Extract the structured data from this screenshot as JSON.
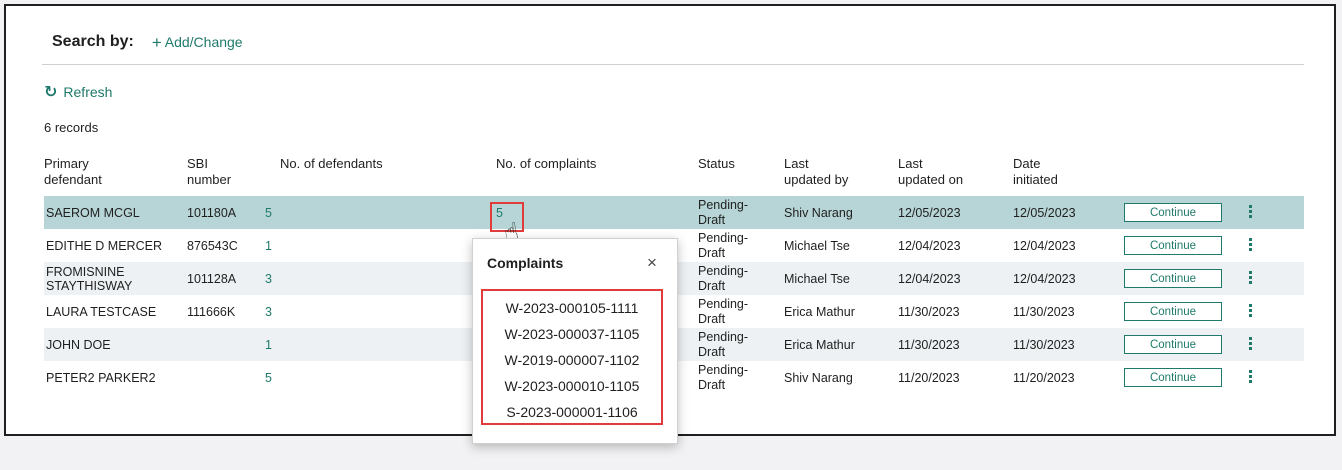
{
  "search": {
    "label": "Search by:",
    "add_change": "Add/Change"
  },
  "refresh_label": "Refresh",
  "record_count": "6 records",
  "table": {
    "headers": {
      "primary_defendant": [
        "Primary",
        "defendant"
      ],
      "sbi_number": [
        "SBI",
        "number"
      ],
      "num_defendants": "No. of defendants",
      "num_complaints": "No. of complaints",
      "status": "Status",
      "last_updated_by": [
        "Last",
        "updated by"
      ],
      "last_updated_on": [
        "Last",
        "updated on"
      ],
      "date_initiated": [
        "Date",
        "initiated"
      ]
    },
    "continue_label": "Continue",
    "rows": [
      {
        "defendant": [
          "SAEROM MCGL"
        ],
        "sbi": "101180A",
        "defendants": "5",
        "complaints": "5",
        "status": [
          "Pending-",
          "Draft"
        ],
        "updated_by": "Shiv Narang",
        "updated_on": "12/05/2023",
        "initiated": "12/05/2023"
      },
      {
        "defendant": [
          "EDITHE D MERCER"
        ],
        "sbi": "876543C",
        "defendants": "1",
        "complaints": "",
        "status": [
          "Pending-",
          "Draft"
        ],
        "updated_by": "Michael Tse",
        "updated_on": "12/04/2023",
        "initiated": "12/04/2023"
      },
      {
        "defendant": [
          "FROMISNINE",
          "STAYTHISWAY"
        ],
        "sbi": "101128A",
        "defendants": "3",
        "complaints": "",
        "status": [
          "Pending-",
          "Draft"
        ],
        "updated_by": "Michael Tse",
        "updated_on": "12/04/2023",
        "initiated": "12/04/2023"
      },
      {
        "defendant": [
          "LAURA TESTCASE"
        ],
        "sbi": "111666K",
        "defendants": "3",
        "complaints": "",
        "status": [
          "Pending-",
          "Draft"
        ],
        "updated_by": "Erica Mathur",
        "updated_on": "11/30/2023",
        "initiated": "11/30/2023"
      },
      {
        "defendant": [
          "JOHN DOE"
        ],
        "sbi": "",
        "defendants": "1",
        "complaints": "",
        "status": [
          "Pending-",
          "Draft"
        ],
        "updated_by": "Erica Mathur",
        "updated_on": "11/30/2023",
        "initiated": "11/30/2023"
      },
      {
        "defendant": [
          "PETER2 PARKER2"
        ],
        "sbi": "",
        "defendants": "5",
        "complaints": "",
        "status": [
          "Pending-",
          "Draft"
        ],
        "updated_by": "Shiv Narang",
        "updated_on": "11/20/2023",
        "initiated": "11/20/2023"
      }
    ]
  },
  "complaints_popup": {
    "title": "Complaints",
    "close_symbol": "×",
    "items": [
      "W-2023-000105-1111",
      "W-2023-000037-1105",
      "W-2019-000007-1102",
      "W-2023-000010-1105",
      "S-2023-000001-1106"
    ]
  },
  "icons": {
    "refresh": "refresh-icon",
    "plus": "plus-icon",
    "close": "close-icon",
    "kebab": "kebab-menu-icon",
    "cursor": "hand-pointer-icon"
  },
  "colors": {
    "accent": "#1f7a6b",
    "selected_row": "#b7d5d6",
    "stripe_row": "#edf1f3",
    "highlight": "#e03c3c"
  }
}
